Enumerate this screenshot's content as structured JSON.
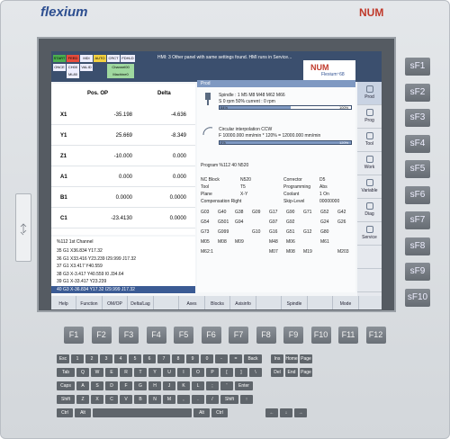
{
  "brand": {
    "left": "flexium",
    "right": "NUM"
  },
  "status": {
    "modes": [
      "START",
      "FEED",
      "MDI",
      "AUTO",
      "CRCT",
      "FDHLD",
      "ONCE",
      "CH00",
      "VALID",
      "ML80",
      "Channel00",
      "Machine0"
    ],
    "message": "HMI: 3 Other panel with same settings found. HMI runs in Service...",
    "logo": "NUM",
    "product": "Flexium⁺68"
  },
  "axes_panel": {
    "col_pos": "Pos. OP",
    "col_delta": "Delta",
    "rows": [
      {
        "axis": "X1",
        "pos": "-35.198",
        "delta": "-4.636"
      },
      {
        "axis": "Y1",
        "pos": "25.669",
        "delta": "-8.349"
      },
      {
        "axis": "Z1",
        "pos": "-10.000",
        "delta": "0.000"
      },
      {
        "axis": "A1",
        "pos": "0.000",
        "delta": "0.000"
      },
      {
        "axis": "B1",
        "pos": "0.0000",
        "delta": "0.0000"
      },
      {
        "axis": "C1",
        "pos": "-23.4130",
        "delta": "0.0000"
      }
    ]
  },
  "program": {
    "channel_title": "%112 1st Channel",
    "lines": [
      "35 G1 X36.834 Y17.32",
      "36 G1 X33.416 Y23.239 I29.999 J17.32",
      "37 G1 X3.417 Y40.559",
      "38 G3 X-3.417 Y40.559 I0 J34.64",
      "39 G1 X-33.417 Y23.239",
      "40 G3 X-36.834 Y17.32 I29.999 J17.32"
    ],
    "header": "Program %112 40 N520"
  },
  "spindle": {
    "title": "Spindle : 1   M5 M8 M48 M62 M66",
    "line2": "S 0 rpm   50% current : 0 rpm",
    "bar_pct": 54,
    "bar_left": "54%",
    "bar_right": "100%"
  },
  "feed": {
    "title": "Circular interpolation CCW",
    "line2": "F 10000.000 mm/min * 120% = 12000.000 mm/min",
    "bar_pct": 100,
    "bar_left": "0%",
    "bar_right": "120%"
  },
  "info": {
    "nc_block_label": "NC Block",
    "nc_block": "N520",
    "tool_label": "Tool",
    "tool": "T5",
    "plane_label": "Plane",
    "plane": "X-Y",
    "comp_label": "Compensation Right",
    "corr_label": "Corrector",
    "corr": "D5",
    "prog_label": "Programming",
    "prog": "Abs",
    "cool_label": "Coolant",
    "cool": "1 On",
    "skip_label": "Skip-Level",
    "skip": "00000000"
  },
  "gcodes": [
    [
      "G03",
      "G40",
      "G38",
      "G09",
      "G17",
      "G90",
      "G71",
      "G52",
      "G42"
    ],
    [
      "G54",
      "G501",
      "G94",
      "",
      "G97",
      "G92",
      "",
      "G24",
      "G26"
    ],
    [
      "G73",
      "G999",
      "",
      "G10",
      "G16",
      "G51",
      "G12",
      "G80",
      ""
    ],
    [
      "M05",
      "M08",
      "M09",
      "",
      "M48",
      "M06",
      "",
      "M61",
      ""
    ],
    [
      "M62:1",
      "",
      "",
      "",
      "M07",
      "M08",
      "M19",
      "",
      "M203"
    ]
  ],
  "vertical_softkeys": [
    "Prod",
    "Prog",
    "Tool",
    "Work",
    "Variable",
    "Diag",
    "Service",
    "",
    ""
  ],
  "bottom_softkeys": [
    "Help",
    "Function",
    "OM/OP",
    "Delta/Lag",
    "",
    "Axes",
    "Blocks",
    "Axisinfo",
    "",
    "Spindle",
    "",
    "Mode"
  ],
  "side_keys": [
    "sF1",
    "sF2",
    "sF3",
    "sF4",
    "sF5",
    "sF6",
    "sF7",
    "sF8",
    "sF9",
    "sF10"
  ],
  "function_keys": [
    "F1",
    "F2",
    "F3",
    "F4",
    "F5",
    "F6",
    "F7",
    "F8",
    "F9",
    "F10",
    "F11",
    "F12"
  ],
  "keyboard": {
    "row1": [
      "Esc",
      "1",
      "2",
      "3",
      "4",
      "5",
      "6",
      "7",
      "8",
      "9",
      "0",
      "-",
      "=",
      "Back",
      "Ins",
      "Home",
      "Page Up"
    ],
    "row2": [
      "Tab",
      "Q",
      "W",
      "E",
      "R",
      "T",
      "Y",
      "U",
      "I",
      "O",
      "P",
      "[",
      "]",
      "\\",
      "Del",
      "End",
      "Page Down"
    ],
    "row3": [
      "Caps Lock",
      "A",
      "S",
      "D",
      "F",
      "G",
      "H",
      "J",
      "K",
      "L",
      ";",
      "'",
      "Enter"
    ],
    "row4": [
      "Shift",
      "Z",
      "X",
      "C",
      "V",
      "B",
      "N",
      "M",
      ",",
      ".",
      "/",
      "Shift",
      "↑"
    ],
    "row5": [
      "Ctrl",
      "Alt",
      "",
      "Alt",
      "Ctrl",
      "←",
      "↓",
      "→"
    ]
  }
}
